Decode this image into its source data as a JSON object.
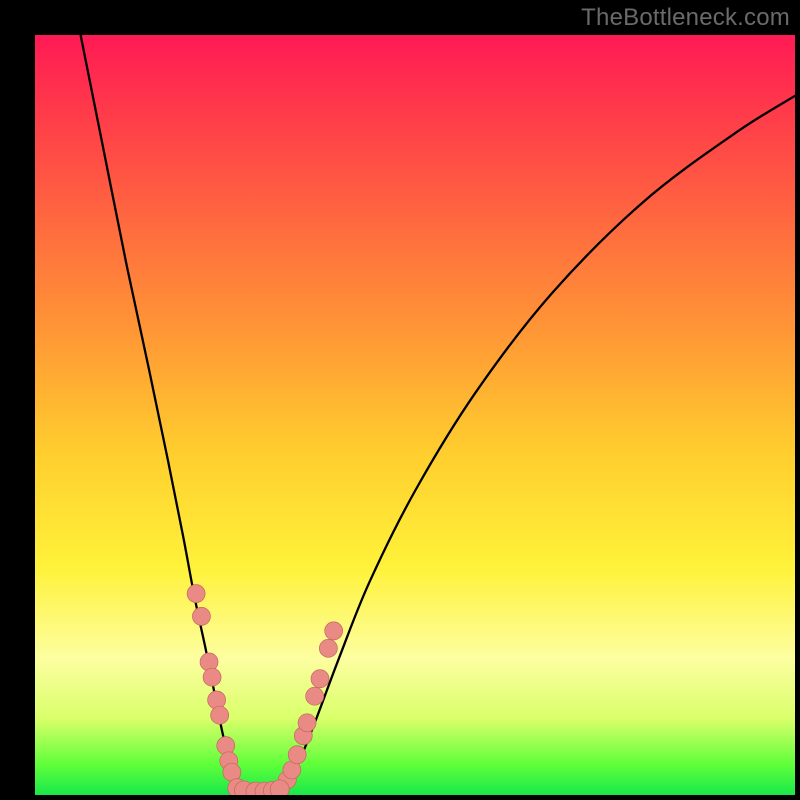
{
  "watermark": "TheBottleneck.com",
  "colors": {
    "frame": "#000000",
    "curve": "#000000",
    "bead_fill": "#e98a85",
    "bead_stroke": "#c46560",
    "gradient_stops": [
      "#ff1a55",
      "#ff3a4a",
      "#ff6a3f",
      "#ff9a35",
      "#ffce2e",
      "#fff23a",
      "#fdfea0",
      "#d9ff6a",
      "#5fff3a",
      "#19e84a"
    ]
  },
  "chart_data": {
    "type": "line",
    "title": "",
    "xlabel": "",
    "ylabel": "",
    "categories": [],
    "x_range": [
      0,
      100
    ],
    "y_range": [
      0,
      100
    ],
    "note": "x and y are in percent of the plot area; origin at bottom-left. Axes are unlabeled in the source image; values are geometric estimates from pixels.",
    "series": [
      {
        "name": "left-curve",
        "x": [
          6,
          9,
          12,
          15,
          17.5,
          19.5,
          21,
          22.5,
          23.7,
          24.6,
          25.3,
          25.8,
          26.2,
          26.5,
          26.8
        ],
        "y": [
          100,
          85,
          70,
          56,
          44,
          34,
          26,
          19,
          13,
          8.5,
          5.5,
          3.5,
          2,
          1,
          0.5
        ]
      },
      {
        "name": "trough-curve",
        "x": [
          26.8,
          27.5,
          28.5,
          29.5,
          30.5,
          31.5,
          32.3
        ],
        "y": [
          0.5,
          0.3,
          0.25,
          0.25,
          0.3,
          0.4,
          0.6
        ]
      },
      {
        "name": "right-curve",
        "x": [
          32.3,
          33.5,
          35,
          37,
          40,
          44,
          50,
          58,
          68,
          80,
          92,
          100
        ],
        "y": [
          0.6,
          2,
          5,
          10,
          18,
          28,
          40,
          53,
          66,
          78,
          87,
          92
        ]
      }
    ],
    "beads_left": {
      "name": "left-beads",
      "x": [
        21.2,
        21.9,
        22.9,
        23.3,
        23.9,
        24.3,
        25.1,
        25.5,
        25.9
      ],
      "y": [
        26.5,
        23.5,
        17.5,
        15.5,
        12.5,
        10.5,
        6.5,
        4.5,
        3
      ]
    },
    "beads_right": {
      "name": "right-beads",
      "x": [
        33.2,
        33.8,
        34.5,
        35.3,
        35.8,
        36.8,
        37.5,
        38.6,
        39.3
      ],
      "y": [
        2,
        3.3,
        5.3,
        7.8,
        9.5,
        13,
        15.3,
        19.3,
        21.6
      ]
    },
    "beads_bottom": {
      "name": "bottom-beads",
      "x": [
        26.6,
        27.5,
        29.0,
        30.2,
        31.3,
        32.2
      ],
      "y": [
        0.9,
        0.6,
        0.45,
        0.45,
        0.55,
        0.75
      ]
    }
  }
}
